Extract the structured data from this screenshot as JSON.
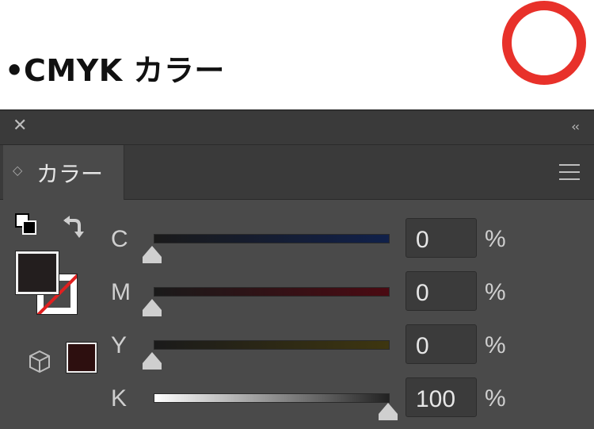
{
  "heading": {
    "bullet": "•",
    "text": "CMYK カラー"
  },
  "annotation": {
    "color": "#e8312a"
  },
  "panel": {
    "close_icon": "✕",
    "collapse_icon": "‹‹",
    "tab_label": "カラー",
    "tab_arrows": "◇",
    "fill_color": "#231e1e",
    "swatch_color": "#2d0f0f"
  },
  "channels": [
    {
      "label": "C",
      "value": "0",
      "unit": "%",
      "gradient_end": "#10204a"
    },
    {
      "label": "M",
      "value": "0",
      "unit": "%",
      "gradient_end": "#4a0a12"
    },
    {
      "label": "Y",
      "value": "0",
      "unit": "%",
      "gradient_end": "#3e3610"
    },
    {
      "label": "K",
      "value": "100",
      "unit": "%",
      "gradient_start": "#ffffff",
      "gradient_end": "#222222"
    }
  ]
}
